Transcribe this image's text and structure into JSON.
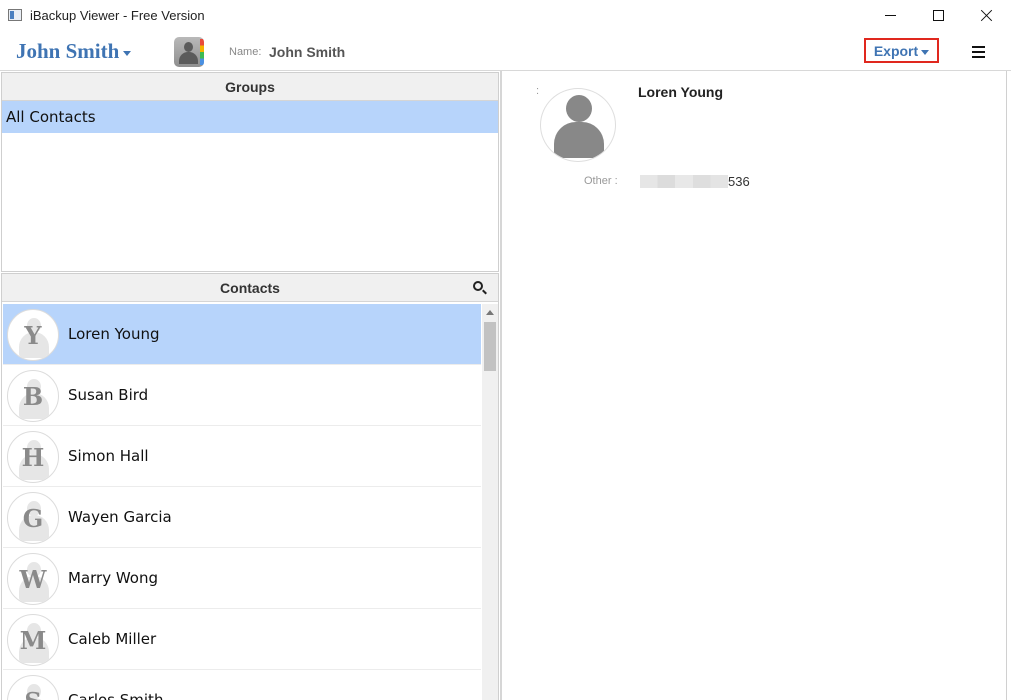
{
  "window": {
    "title": "iBackup Viewer - Free Version"
  },
  "header": {
    "device_name": "John Smith",
    "name_label": "Name:",
    "name_value": "John Smith",
    "export_label": "Export"
  },
  "groups": {
    "header": "Groups",
    "items": [
      {
        "label": "All Contacts"
      }
    ]
  },
  "contacts": {
    "header": "Contacts",
    "items": [
      {
        "initial": "Y",
        "name": "Loren Young"
      },
      {
        "initial": "B",
        "name": "Susan Bird"
      },
      {
        "initial": "H",
        "name": "Simon Hall"
      },
      {
        "initial": "G",
        "name": "Wayen Garcia"
      },
      {
        "initial": "W",
        "name": "Marry Wong"
      },
      {
        "initial": "M",
        "name": "Caleb Miller"
      },
      {
        "initial": "S",
        "name": "Carlos Smith"
      }
    ]
  },
  "detail": {
    "colon": ":",
    "name": "Loren Young",
    "field_label": "Other :",
    "field_value_visible": "536"
  },
  "colors": {
    "accent": "#3f74b3",
    "selection": "#b7d4fb",
    "export_highlight": "#e0281e"
  }
}
